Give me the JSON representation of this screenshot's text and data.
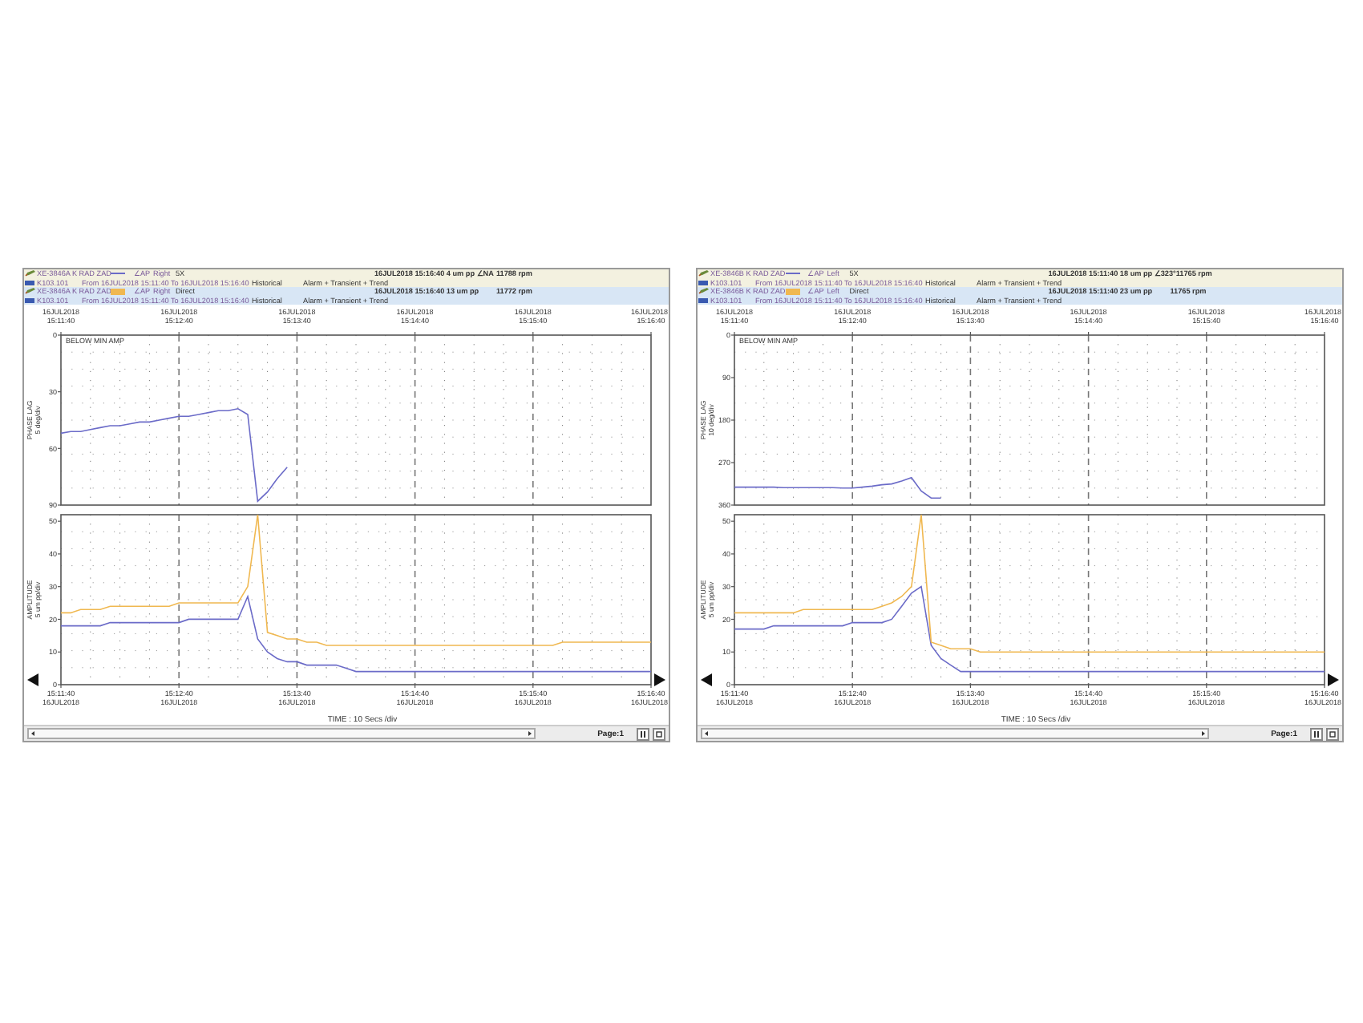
{
  "panels": [
    {
      "channels": [
        {
          "kind": "line",
          "color": "#6b6bc8",
          "selected": false,
          "point": "XE-3846A K RAD ZAD",
          "angle": "∠AP",
          "side": "Right",
          "filter": "5X",
          "reading": "16JUL2018 15:16:40 4 um pp ∠NA",
          "speed": "11788 rpm",
          "machine": "K103.101",
          "range": "From 16JUL2018 15:11:40 To 16JUL2018 15:16:40",
          "mode": "Historical",
          "collection": "Alarm + Transient + Trend"
        },
        {
          "kind": "box",
          "color": "#f0b850",
          "selected": true,
          "point": "XE-3846A K RAD ZAD",
          "angle": "∠AP",
          "side": "Right",
          "filter": "Direct",
          "reading": "16JUL2018 15:16:40 13 um pp",
          "speed": "11772 rpm",
          "machine": "K103.101",
          "range": "From 16JUL2018 15:11:40 To 16JUL2018 15:16:40",
          "mode": "Historical",
          "collection": "Alarm + Transient + Trend"
        }
      ],
      "phase": {
        "dates": [
          "16JUL2018",
          "16JUL2018",
          "16JUL2018",
          "16JUL2018",
          "16JUL2018",
          "16JUL2018"
        ],
        "note": "BELOW MIN AMP",
        "scale": "5 deg/div",
        "chart_data": {
          "type": "line",
          "ylabel": "PHASE LAG",
          "grid": true,
          "ylim": [
            90,
            0
          ],
          "yticks": [
            0,
            30,
            60,
            90
          ],
          "categories": [
            "15:11:40",
            null,
            null,
            null,
            null,
            null,
            null,
            null,
            null,
            null,
            null,
            null,
            "15:12:40",
            null,
            null,
            null,
            null,
            null,
            null,
            null,
            null,
            null,
            null,
            null,
            "15:13:40",
            null,
            null,
            null,
            null,
            null,
            null,
            null,
            null,
            null,
            null,
            null,
            "15:14:40",
            null,
            null,
            null,
            null,
            null,
            null,
            null,
            null,
            null,
            null,
            null,
            "15:15:40",
            null,
            null,
            null,
            null,
            null,
            null,
            null,
            null,
            null,
            null,
            null,
            "15:16:40"
          ],
          "series": [
            {
              "color": "#6b6bc8",
              "values": [
                52,
                51,
                51,
                50,
                49,
                48,
                48,
                47,
                46,
                46,
                45,
                44,
                43,
                43,
                42,
                41,
                40,
                40,
                39,
                42,
                88,
                83,
                76,
                70,
                null,
                null,
                null,
                null,
                null,
                null,
                null,
                null,
                null,
                null,
                null,
                null,
                null,
                null,
                null,
                null,
                null,
                null,
                null,
                null,
                null,
                null,
                null,
                null,
                null,
                null,
                null,
                null,
                null,
                null,
                null,
                null,
                null,
                null,
                null,
                null,
                null
              ]
            }
          ]
        }
      },
      "amplitude": {
        "dates": [
          "16JUL2018",
          "16JUL2018",
          "16JUL2018",
          "16JUL2018",
          "16JUL2018",
          "16JUL2018"
        ],
        "scale": "5 um pp/div",
        "chart_data": {
          "type": "line",
          "ylabel": "AMPLITUDE",
          "grid": true,
          "ylim": [
            0,
            52
          ],
          "yticks": [
            0,
            10,
            20,
            30,
            40,
            50
          ],
          "categories": [
            "15:11:40",
            null,
            null,
            null,
            null,
            null,
            null,
            null,
            null,
            null,
            null,
            null,
            "15:12:40",
            null,
            null,
            null,
            null,
            null,
            null,
            null,
            null,
            null,
            null,
            null,
            "15:13:40",
            null,
            null,
            null,
            null,
            null,
            null,
            null,
            null,
            null,
            null,
            null,
            "15:14:40",
            null,
            null,
            null,
            null,
            null,
            null,
            null,
            null,
            null,
            null,
            null,
            "15:15:40",
            null,
            null,
            null,
            null,
            null,
            null,
            null,
            null,
            null,
            null,
            null,
            "15:16:40"
          ],
          "series": [
            {
              "color": "#6b6bc8",
              "values": [
                18,
                18,
                18,
                18,
                18,
                19,
                19,
                19,
                19,
                19,
                19,
                19,
                19,
                20,
                20,
                20,
                20,
                20,
                20,
                27,
                14,
                10,
                8,
                7,
                7,
                6,
                6,
                6,
                6,
                5,
                4,
                4,
                4,
                4,
                4,
                4,
                4,
                4,
                4,
                4,
                4,
                4,
                4,
                4,
                4,
                4,
                4,
                4,
                4,
                4,
                4,
                4,
                4,
                4,
                4,
                4,
                4,
                4,
                4,
                4,
                4
              ]
            },
            {
              "color": "#f0b850",
              "values": [
                22,
                22,
                23,
                23,
                23,
                24,
                24,
                24,
                24,
                24,
                24,
                24,
                25,
                25,
                25,
                25,
                25,
                25,
                25,
                30,
                52,
                16,
                15,
                14,
                14,
                13,
                13,
                12,
                12,
                12,
                12,
                12,
                12,
                12,
                12,
                12,
                12,
                12,
                12,
                12,
                12,
                12,
                12,
                12,
                12,
                12,
                12,
                12,
                12,
                12,
                12,
                13,
                13,
                13,
                13,
                13,
                13,
                13,
                13,
                13,
                13
              ]
            }
          ]
        }
      },
      "time_scale": "TIME : 10 Secs /div",
      "page": "Page:1"
    },
    {
      "channels": [
        {
          "kind": "line",
          "color": "#6b6bc8",
          "selected": false,
          "point": "XE-3846B K RAD ZAD",
          "angle": "∠AP",
          "side": "Left",
          "filter": "5X",
          "reading": "16JUL2018 15:11:40 18 um pp ∠323°",
          "speed": "11765 rpm",
          "machine": "K103.101",
          "range": "From 16JUL2018 15:11:40 To 16JUL2018 15:16:40",
          "mode": "Historical",
          "collection": "Alarm + Transient + Trend"
        },
        {
          "kind": "box",
          "color": "#f0b850",
          "selected": true,
          "point": "XE-3846B K RAD ZAD",
          "angle": "∠AP",
          "side": "Left",
          "filter": "Direct",
          "reading": "16JUL2018 15:11:40 23 um pp",
          "speed": "11765 rpm",
          "machine": "K103.101",
          "range": "From 16JUL2018 15:11:40 To 16JUL2018 15:16:40",
          "mode": "Historical",
          "collection": "Alarm + Transient + Trend"
        }
      ],
      "phase": {
        "dates": [
          "16JUL2018",
          "16JUL2018",
          "16JUL2018",
          "16JUL2018",
          "16JUL2018",
          "16JUL2018"
        ],
        "note": "BELOW MIN AMP",
        "scale": "10 deg/div",
        "chart_data": {
          "type": "line",
          "ylabel": "PHASE LAG",
          "grid": true,
          "ylim": [
            360,
            0
          ],
          "yticks": [
            0,
            90,
            180,
            270,
            360
          ],
          "categories": [
            "15:11:40",
            null,
            null,
            null,
            null,
            null,
            null,
            null,
            null,
            null,
            null,
            null,
            "15:12:40",
            null,
            null,
            null,
            null,
            null,
            null,
            null,
            null,
            null,
            null,
            null,
            "15:13:40",
            null,
            null,
            null,
            null,
            null,
            null,
            null,
            null,
            null,
            null,
            null,
            "15:14:40",
            null,
            null,
            null,
            null,
            null,
            null,
            null,
            null,
            null,
            null,
            null,
            "15:15:40",
            null,
            null,
            null,
            null,
            null,
            null,
            null,
            null,
            null,
            null,
            null,
            "15:16:40"
          ],
          "series": [
            {
              "color": "#6b6bc8",
              "values": [
                322,
                322,
                322,
                322,
                322,
                323,
                323,
                323,
                323,
                323,
                323,
                324,
                324,
                322,
                320,
                317,
                315,
                309,
                302,
                330,
                345,
                345,
                null,
                null,
                null,
                null,
                null,
                null,
                null,
                null,
                null,
                null,
                null,
                null,
                null,
                null,
                null,
                null,
                null,
                null,
                null,
                null,
                null,
                null,
                null,
                null,
                null,
                null,
                null,
                null,
                null,
                null,
                null,
                null,
                null,
                null,
                null,
                null,
                null,
                null,
                null
              ]
            }
          ]
        }
      },
      "amplitude": {
        "dates": [
          "16JUL2018",
          "16JUL2018",
          "16JUL2018",
          "16JUL2018",
          "16JUL2018",
          "16JUL2018"
        ],
        "scale": "5 um pp/div",
        "chart_data": {
          "type": "line",
          "ylabel": "AMPLITUDE",
          "grid": true,
          "ylim": [
            0,
            52
          ],
          "yticks": [
            0,
            10,
            20,
            30,
            40,
            50
          ],
          "categories": [
            "15:11:40",
            null,
            null,
            null,
            null,
            null,
            null,
            null,
            null,
            null,
            null,
            null,
            "15:12:40",
            null,
            null,
            null,
            null,
            null,
            null,
            null,
            null,
            null,
            null,
            null,
            "15:13:40",
            null,
            null,
            null,
            null,
            null,
            null,
            null,
            null,
            null,
            null,
            null,
            "15:14:40",
            null,
            null,
            null,
            null,
            null,
            null,
            null,
            null,
            null,
            null,
            null,
            "15:15:40",
            null,
            null,
            null,
            null,
            null,
            null,
            null,
            null,
            null,
            null,
            null,
            "15:16:40"
          ],
          "series": [
            {
              "color": "#6b6bc8",
              "values": [
                17,
                17,
                17,
                17,
                18,
                18,
                18,
                18,
                18,
                18,
                18,
                18,
                19,
                19,
                19,
                19,
                20,
                24,
                28,
                30,
                12,
                8,
                6,
                4,
                4,
                4,
                4,
                4,
                4,
                4,
                4,
                4,
                4,
                4,
                4,
                4,
                4,
                4,
                4,
                4,
                4,
                4,
                4,
                4,
                4,
                4,
                4,
                4,
                4,
                4,
                4,
                4,
                4,
                4,
                4,
                4,
                4,
                4,
                4,
                4,
                4
              ]
            },
            {
              "color": "#f0b850",
              "values": [
                22,
                22,
                22,
                22,
                22,
                22,
                22,
                23,
                23,
                23,
                23,
                23,
                23,
                23,
                23,
                24,
                25,
                27,
                30,
                52,
                13,
                12,
                11,
                11,
                11,
                10,
                10,
                10,
                10,
                10,
                10,
                10,
                10,
                10,
                10,
                10,
                10,
                10,
                10,
                10,
                10,
                10,
                10,
                10,
                10,
                10,
                10,
                10,
                10,
                10,
                10,
                10,
                10,
                10,
                10,
                10,
                10,
                10,
                10,
                10,
                10
              ]
            }
          ]
        }
      },
      "time_scale": "TIME : 10 Secs /div",
      "page": "Page:1"
    }
  ]
}
